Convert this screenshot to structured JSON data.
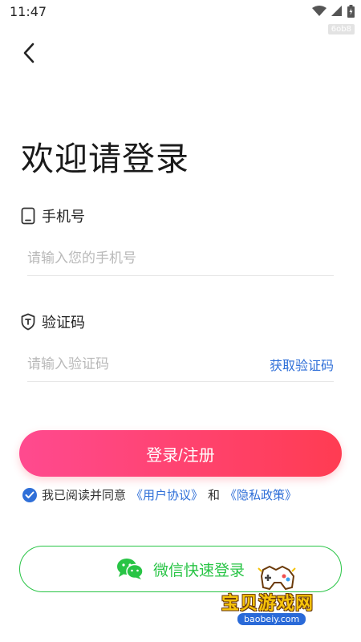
{
  "status_bar": {
    "time": "11:47",
    "device_tag": "6ob8"
  },
  "page": {
    "title": "欢迎请登录"
  },
  "phone_field": {
    "label": "手机号",
    "placeholder": "请输入您的手机号",
    "icon": "phone-icon"
  },
  "code_field": {
    "label": "验证码",
    "placeholder": "请输入验证码",
    "get_code_label": "获取验证码",
    "icon": "shield-icon"
  },
  "login_button": {
    "label": "登录/注册"
  },
  "agreement": {
    "checked": true,
    "prefix": "我已阅读并同意",
    "user_agreement": "《用户协议》",
    "conjunction": "和",
    "privacy_policy": "《隐私政策》"
  },
  "wechat_login": {
    "label": "微信快速登录",
    "icon": "wechat-icon"
  },
  "watermark": {
    "title": "宝贝游戏网",
    "url": "baobeiy.com"
  },
  "colors": {
    "accent_blue": "#2f6fd8",
    "wechat_green": "#28c445",
    "gradient_start": "#ff4a8f",
    "gradient_end": "#ff3c52"
  }
}
